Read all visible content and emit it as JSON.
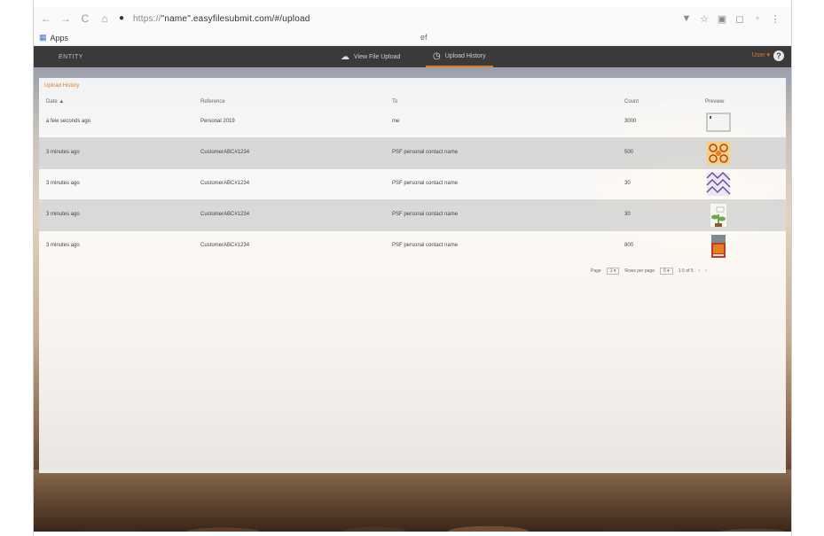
{
  "browser": {
    "url_prefix": "https://",
    "url": "\"name\".easyfilesubmit.com/#/upload",
    "bookmarks_label": "Apps",
    "bookmark_center": "ef"
  },
  "app": {
    "name": "ENTITY",
    "nav": [
      {
        "label": "View File Upload",
        "icon": "cloud-upload-icon"
      },
      {
        "label": "Upload History",
        "icon": "history-icon"
      }
    ],
    "user_label": "User ▾",
    "help_label": "?"
  },
  "history": {
    "title": "Upload History",
    "columns": [
      "Date ▲",
      "Reference",
      "To",
      "Count",
      "Preview"
    ],
    "rows": [
      {
        "date": "a few seconds ago",
        "reference": "Personal 2019",
        "to": "me",
        "count": "3000",
        "thumb": "note"
      },
      {
        "date": "3 minutes ago",
        "reference": "CustomerABC#1234",
        "to": "PSF personal contact name",
        "count": "500",
        "thumb": "pattern-gold"
      },
      {
        "date": "3 minutes ago",
        "reference": "CustomerABC#1234",
        "to": "PSF personal contact name",
        "count": "30",
        "thumb": "pattern-purple"
      },
      {
        "date": "3 minutes ago",
        "reference": "CustomerABC#1234",
        "to": "PSF personal contact name",
        "count": "30",
        "thumb": "plant"
      },
      {
        "date": "3 minutes ago",
        "reference": "CustomerABC#1234",
        "to": "PSF personal contact name",
        "count": "800",
        "thumb": "book"
      }
    ],
    "pager": {
      "page_label": "Page",
      "page_value": "1 ▾",
      "rows_label": "Rows per page",
      "rows_value": "5 ▾",
      "range": "1-5 of 5",
      "prev": "‹",
      "next": "›"
    }
  }
}
